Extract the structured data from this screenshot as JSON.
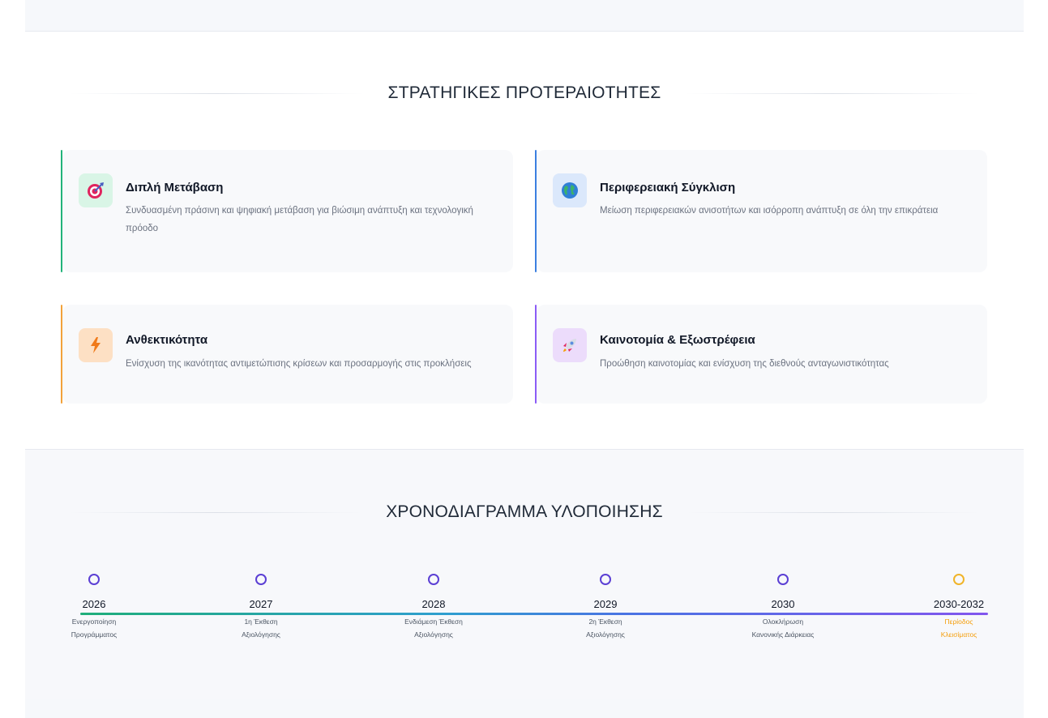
{
  "priorities": {
    "title": "ΣΤΡΑΤΗΓΙΚΕΣ ΠΡΟΤΕΡΑΙΟΤΗΤΕΣ",
    "cards": [
      {
        "icon": "target-icon",
        "accent": "#22b37a",
        "icon_bg": "#d9f5e6",
        "title": "Διπλή Μετάβαση",
        "description": "Συνδυασμένη πράσινη και ψηφιακή μετάβαση για βιώσιμη ανάπτυξη και τεχνολογική πρόοδο"
      },
      {
        "icon": "globe-icon",
        "accent": "#3b7fe0",
        "icon_bg": "#dbe8fb",
        "title": "Περιφερειακή Σύγκλιση",
        "description": "Μείωση περιφερειακών ανισοτήτων και ισόρροπη ανάπτυξη σε όλη την επικράτεια"
      },
      {
        "icon": "lightning-icon",
        "accent": "#f2a23a",
        "icon_bg": "#fde0c4",
        "title": "Ανθεκτικότητα",
        "description": "Ενίσχυση της ικανότητας αντιμετώπισης κρίσεων και προσαρμογής στις προκλήσεις"
      },
      {
        "icon": "rocket-icon",
        "accent": "#8b5cf6",
        "icon_bg": "#ecdcfb",
        "title": "Καινοτομία & Εξωστρέφεια",
        "description": "Προώθηση καινοτομίας και ενίσχυση της διεθνούς ανταγωνιστικότητας"
      }
    ]
  },
  "timeline": {
    "title": "ΧΡΟΝΟΔΙΑΓΡΑΜΜΑ ΥΛΟΠΟΙΗΣΗΣ",
    "milestones": [
      {
        "year": "2026",
        "line1": "Ενεργοποίηση",
        "line2": "Προγράμματος",
        "color": "#5b3fd4"
      },
      {
        "year": "2027",
        "line1": "1η Έκθεση",
        "line2": "Αξιολόγησης",
        "color": "#5b3fd4"
      },
      {
        "year": "2028",
        "line1": "Ενδιάμεση Έκθεση",
        "line2": "Αξιολόγησης",
        "color": "#5b3fd4"
      },
      {
        "year": "2029",
        "line1": "2η Έκθεση",
        "line2": "Αξιολόγησης",
        "color": "#5b3fd4"
      },
      {
        "year": "2030",
        "line1": "Ολοκλήρωση",
        "line2": "Κανονικής Διάρκειας",
        "color": "#5b3fd4"
      },
      {
        "year": "2030-2032",
        "line1": "Περίοδος",
        "line2": "Κλεισίματος",
        "color": "#f0b429"
      }
    ]
  }
}
